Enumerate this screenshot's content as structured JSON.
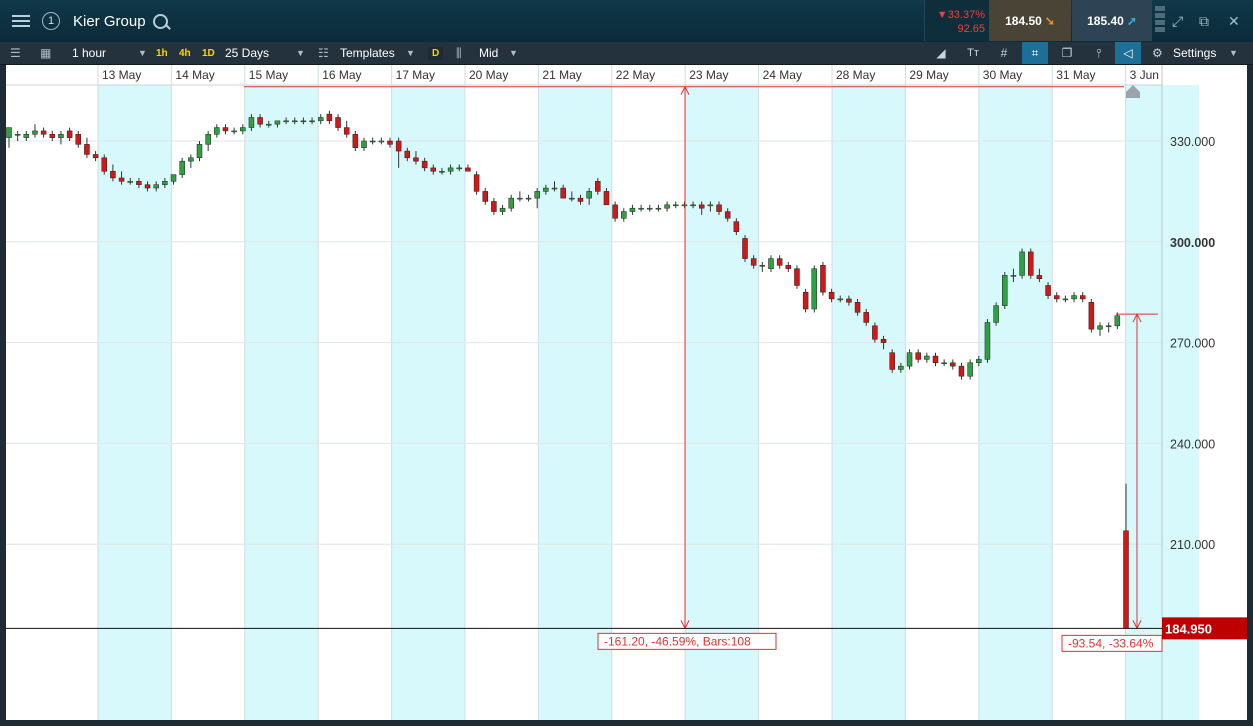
{
  "header": {
    "title": "Kier Group",
    "account_badge": "1",
    "change_percent": "33.37%",
    "change_abs": "92.65",
    "sell_price": "184.50",
    "buy_price": "185.40"
  },
  "toolbar": {
    "interval": "1 hour",
    "quick_1h": "1h",
    "quick_4h": "4h",
    "quick_1d": "1D",
    "range": "25 Days",
    "templates": "Templates",
    "d_badge": "D",
    "price_type": "Mid",
    "settings": "Settings"
  },
  "chart_data": {
    "type": "candlestick",
    "x_dates": [
      "13 May",
      "14 May",
      "15 May",
      "16 May",
      "17 May",
      "20 May",
      "21 May",
      "22 May",
      "23 May",
      "24 May",
      "28 May",
      "29 May",
      "30 May",
      "31 May",
      "3 Jun"
    ],
    "y_ticks": [
      "330.000",
      "300.000",
      "270.000",
      "240.000",
      "210.000"
    ],
    "y_tick_values": [
      330,
      300,
      270,
      240,
      210
    ],
    "current_price_label": "184.950",
    "current_price": 184.95,
    "measure_1_label": "-161.20, -46.59%, Bars:108",
    "measure_2_label": "-93.54, -33.64%",
    "measure_1_from": 346.15,
    "measure_2_from": 278.49,
    "ylim": [
      160,
      346
    ],
    "series": [
      {
        "o": 331,
        "h": 334,
        "l": 328,
        "c": 334
      },
      {
        "o": 332,
        "h": 333,
        "l": 330,
        "c": 332
      },
      {
        "o": 331,
        "h": 333,
        "l": 330,
        "c": 332
      },
      {
        "o": 332,
        "h": 335,
        "l": 331,
        "c": 333
      },
      {
        "o": 333,
        "h": 334,
        "l": 331,
        "c": 332
      },
      {
        "o": 332,
        "h": 333,
        "l": 330,
        "c": 331
      },
      {
        "o": 331,
        "h": 333,
        "l": 329,
        "c": 332
      },
      {
        "o": 333,
        "h": 334,
        "l": 330,
        "c": 331
      },
      {
        "o": 332,
        "h": 333,
        "l": 328,
        "c": 329
      },
      {
        "o": 329,
        "h": 331,
        "l": 325,
        "c": 326
      },
      {
        "o": 326,
        "h": 327,
        "l": 324,
        "c": 325
      },
      {
        "o": 325,
        "h": 326,
        "l": 320,
        "c": 321
      },
      {
        "o": 321,
        "h": 323,
        "l": 318,
        "c": 319
      },
      {
        "o": 319,
        "h": 321,
        "l": 317,
        "c": 318
      },
      {
        "o": 318,
        "h": 319,
        "l": 317,
        "c": 318
      },
      {
        "o": 318,
        "h": 319,
        "l": 316,
        "c": 317
      },
      {
        "o": 317,
        "h": 318,
        "l": 315,
        "c": 316
      },
      {
        "o": 316,
        "h": 318,
        "l": 315,
        "c": 317
      },
      {
        "o": 317,
        "h": 319,
        "l": 316,
        "c": 318
      },
      {
        "o": 318,
        "h": 320,
        "l": 317,
        "c": 320
      },
      {
        "o": 320,
        "h": 325,
        "l": 319,
        "c": 324
      },
      {
        "o": 324,
        "h": 326,
        "l": 322,
        "c": 325
      },
      {
        "o": 325,
        "h": 330,
        "l": 324,
        "c": 329
      },
      {
        "o": 329,
        "h": 333,
        "l": 327,
        "c": 332
      },
      {
        "o": 332,
        "h": 335,
        "l": 331,
        "c": 334
      },
      {
        "o": 334,
        "h": 335,
        "l": 332,
        "c": 333
      },
      {
        "o": 333,
        "h": 334,
        "l": 332,
        "c": 333
      },
      {
        "o": 333,
        "h": 335,
        "l": 332,
        "c": 334
      },
      {
        "o": 334,
        "h": 338,
        "l": 333,
        "c": 337
      },
      {
        "o": 337,
        "h": 338,
        "l": 334,
        "c": 335
      },
      {
        "o": 335,
        "h": 336,
        "l": 334,
        "c": 335
      },
      {
        "o": 335,
        "h": 336,
        "l": 334,
        "c": 336
      },
      {
        "o": 336,
        "h": 337,
        "l": 335,
        "c": 336
      },
      {
        "o": 336,
        "h": 337,
        "l": 335,
        "c": 336
      },
      {
        "o": 336,
        "h": 337,
        "l": 335,
        "c": 336
      },
      {
        "o": 336,
        "h": 337,
        "l": 335,
        "c": 336
      },
      {
        "o": 336,
        "h": 338,
        "l": 335,
        "c": 337
      },
      {
        "o": 338,
        "h": 339,
        "l": 335,
        "c": 336
      },
      {
        "o": 337,
        "h": 338,
        "l": 333,
        "c": 334
      },
      {
        "o": 334,
        "h": 336,
        "l": 331,
        "c": 332
      },
      {
        "o": 332,
        "h": 333,
        "l": 327,
        "c": 328
      },
      {
        "o": 328,
        "h": 331,
        "l": 327,
        "c": 330
      },
      {
        "o": 330,
        "h": 331,
        "l": 329,
        "c": 330
      },
      {
        "o": 330,
        "h": 331,
        "l": 329,
        "c": 330
      },
      {
        "o": 330,
        "h": 331,
        "l": 328,
        "c": 329
      },
      {
        "o": 330,
        "h": 331,
        "l": 322,
        "c": 327
      },
      {
        "o": 327,
        "h": 328,
        "l": 324,
        "c": 325
      },
      {
        "o": 325,
        "h": 327,
        "l": 323,
        "c": 324
      },
      {
        "o": 324,
        "h": 325,
        "l": 321,
        "c": 322
      },
      {
        "o": 322,
        "h": 323,
        "l": 320,
        "c": 321
      },
      {
        "o": 321,
        "h": 322,
        "l": 320,
        "c": 321
      },
      {
        "o": 321,
        "h": 323,
        "l": 320,
        "c": 322
      },
      {
        "o": 322,
        "h": 323,
        "l": 321,
        "c": 322
      },
      {
        "o": 322,
        "h": 323,
        "l": 321,
        "c": 321
      },
      {
        "o": 320,
        "h": 321,
        "l": 314,
        "c": 315
      },
      {
        "o": 315,
        "h": 316,
        "l": 311,
        "c": 312
      },
      {
        "o": 312,
        "h": 313,
        "l": 308,
        "c": 309
      },
      {
        "o": 309,
        "h": 311,
        "l": 308,
        "c": 310
      },
      {
        "o": 310,
        "h": 314,
        "l": 309,
        "c": 313
      },
      {
        "o": 313,
        "h": 315,
        "l": 312,
        "c": 313
      },
      {
        "o": 313,
        "h": 314,
        "l": 312,
        "c": 313
      },
      {
        "o": 313,
        "h": 316,
        "l": 310,
        "c": 315
      },
      {
        "o": 315,
        "h": 317,
        "l": 314,
        "c": 316
      },
      {
        "o": 316,
        "h": 318,
        "l": 315,
        "c": 316
      },
      {
        "o": 316,
        "h": 317,
        "l": 313,
        "c": 313
      },
      {
        "o": 313,
        "h": 315,
        "l": 312,
        "c": 313
      },
      {
        "o": 313,
        "h": 314,
        "l": 311,
        "c": 312
      },
      {
        "o": 313,
        "h": 316,
        "l": 311,
        "c": 315
      },
      {
        "o": 318,
        "h": 319,
        "l": 314,
        "c": 315
      },
      {
        "o": 315,
        "h": 316,
        "l": 311,
        "c": 311
      },
      {
        "o": 311,
        "h": 312,
        "l": 306,
        "c": 307
      },
      {
        "o": 307,
        "h": 310,
        "l": 306,
        "c": 309
      },
      {
        "o": 309,
        "h": 311,
        "l": 308,
        "c": 310
      },
      {
        "o": 310,
        "h": 311,
        "l": 309,
        "c": 310
      },
      {
        "o": 310,
        "h": 311,
        "l": 309,
        "c": 310
      },
      {
        "o": 310,
        "h": 311,
        "l": 309,
        "c": 310
      },
      {
        "o": 310,
        "h": 312,
        "l": 309,
        "c": 311
      },
      {
        "o": 311,
        "h": 312,
        "l": 310,
        "c": 311
      },
      {
        "o": 311,
        "h": 312,
        "l": 310,
        "c": 311
      },
      {
        "o": 311,
        "h": 312,
        "l": 310,
        "c": 311
      },
      {
        "o": 311,
        "h": 312,
        "l": 308,
        "c": 310
      },
      {
        "o": 311,
        "h": 312,
        "l": 309,
        "c": 311
      },
      {
        "o": 311,
        "h": 312,
        "l": 308,
        "c": 309
      },
      {
        "o": 309,
        "h": 310,
        "l": 306,
        "c": 307
      },
      {
        "o": 306,
        "h": 307,
        "l": 302,
        "c": 303
      },
      {
        "o": 301,
        "h": 302,
        "l": 294,
        "c": 295
      },
      {
        "o": 295,
        "h": 296,
        "l": 292,
        "c": 293
      },
      {
        "o": 293,
        "h": 294,
        "l": 291,
        "c": 293
      },
      {
        "o": 292,
        "h": 296,
        "l": 291,
        "c": 295
      },
      {
        "o": 295,
        "h": 296,
        "l": 292,
        "c": 293
      },
      {
        "o": 293,
        "h": 294,
        "l": 291,
        "c": 292
      },
      {
        "o": 292,
        "h": 293,
        "l": 286,
        "c": 287
      },
      {
        "o": 285,
        "h": 286,
        "l": 279,
        "c": 280
      },
      {
        "o": 280,
        "h": 293,
        "l": 279,
        "c": 292
      },
      {
        "o": 293,
        "h": 294,
        "l": 284,
        "c": 285
      },
      {
        "o": 285,
        "h": 286,
        "l": 282,
        "c": 283
      },
      {
        "o": 283,
        "h": 284,
        "l": 282,
        "c": 283
      },
      {
        "o": 283,
        "h": 284,
        "l": 281,
        "c": 282
      },
      {
        "o": 282,
        "h": 283,
        "l": 278,
        "c": 279
      },
      {
        "o": 279,
        "h": 280,
        "l": 275,
        "c": 276
      },
      {
        "o": 275,
        "h": 276,
        "l": 270,
        "c": 271
      },
      {
        "o": 271,
        "h": 272,
        "l": 268,
        "c": 270
      },
      {
        "o": 267,
        "h": 268,
        "l": 261,
        "c": 262
      },
      {
        "o": 262,
        "h": 264,
        "l": 261,
        "c": 263
      },
      {
        "o": 263,
        "h": 268,
        "l": 262,
        "c": 267
      },
      {
        "o": 267,
        "h": 268,
        "l": 264,
        "c": 265
      },
      {
        "o": 265,
        "h": 267,
        "l": 264,
        "c": 266
      },
      {
        "o": 266,
        "h": 267,
        "l": 263,
        "c": 264
      },
      {
        "o": 264,
        "h": 265,
        "l": 263,
        "c": 264
      },
      {
        "o": 264,
        "h": 265,
        "l": 262,
        "c": 263
      },
      {
        "o": 263,
        "h": 264,
        "l": 259,
        "c": 260
      },
      {
        "o": 260,
        "h": 265,
        "l": 259,
        "c": 264
      },
      {
        "o": 264,
        "h": 266,
        "l": 263,
        "c": 265
      },
      {
        "o": 265,
        "h": 277,
        "l": 264,
        "c": 276
      },
      {
        "o": 276,
        "h": 282,
        "l": 275,
        "c": 281
      },
      {
        "o": 281,
        "h": 291,
        "l": 280,
        "c": 290
      },
      {
        "o": 290,
        "h": 292,
        "l": 288,
        "c": 290
      },
      {
        "o": 290,
        "h": 298,
        "l": 289,
        "c": 297
      },
      {
        "o": 297,
        "h": 298,
        "l": 289,
        "c": 290
      },
      {
        "o": 290,
        "h": 292,
        "l": 288,
        "c": 289
      },
      {
        "o": 287,
        "h": 288,
        "l": 283,
        "c": 284
      },
      {
        "o": 284,
        "h": 285,
        "l": 282,
        "c": 283
      },
      {
        "o": 283,
        "h": 284,
        "l": 282,
        "c": 283
      },
      {
        "o": 283,
        "h": 285,
        "l": 282,
        "c": 284
      },
      {
        "o": 284,
        "h": 285,
        "l": 282,
        "c": 283
      },
      {
        "o": 282,
        "h": 283,
        "l": 273,
        "c": 274
      },
      {
        "o": 274,
        "h": 276,
        "l": 272,
        "c": 275
      },
      {
        "o": 275,
        "h": 276,
        "l": 273,
        "c": 275
      },
      {
        "o": 275,
        "h": 279,
        "l": 274,
        "c": 278
      },
      {
        "o": 214,
        "h": 228,
        "l": 185,
        "c": 185
      }
    ],
    "colors": {
      "up": "#2ea043",
      "down": "#d01818",
      "band": "#d8f9fb",
      "grid": "#dfe5e8",
      "measure": "#e23232",
      "price_tag": "#c00000"
    }
  }
}
